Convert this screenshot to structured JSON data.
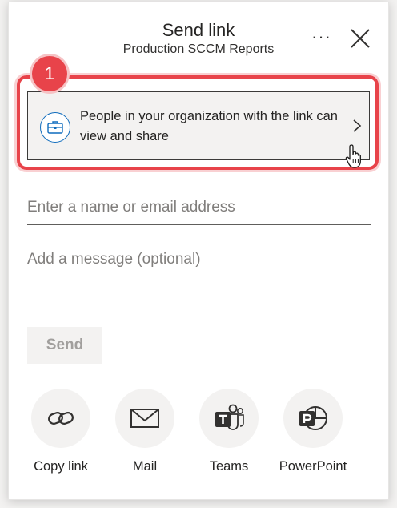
{
  "header": {
    "title": "Send link",
    "subtitle": "Production SCCM Reports",
    "more_label": "···"
  },
  "annotation": {
    "step_number": "1",
    "highlight_color": "#e8434a"
  },
  "link_settings": {
    "icon": "briefcase-icon",
    "text": "People in your organization with the link can view and share"
  },
  "recipient": {
    "placeholder": "Enter a name or email address",
    "value": ""
  },
  "message": {
    "placeholder": "Add a message (optional)",
    "value": ""
  },
  "send_label": "Send",
  "share_options": [
    {
      "label": "Copy link",
      "icon": "link-icon"
    },
    {
      "label": "Mail",
      "icon": "mail-icon"
    },
    {
      "label": "Teams",
      "icon": "teams-icon"
    },
    {
      "label": "PowerPoint",
      "icon": "powerpoint-icon"
    }
  ],
  "colors": {
    "accent_blue": "#0f6cbd",
    "badge_red": "#e8434a",
    "surface_gray": "#f3f2f1"
  }
}
